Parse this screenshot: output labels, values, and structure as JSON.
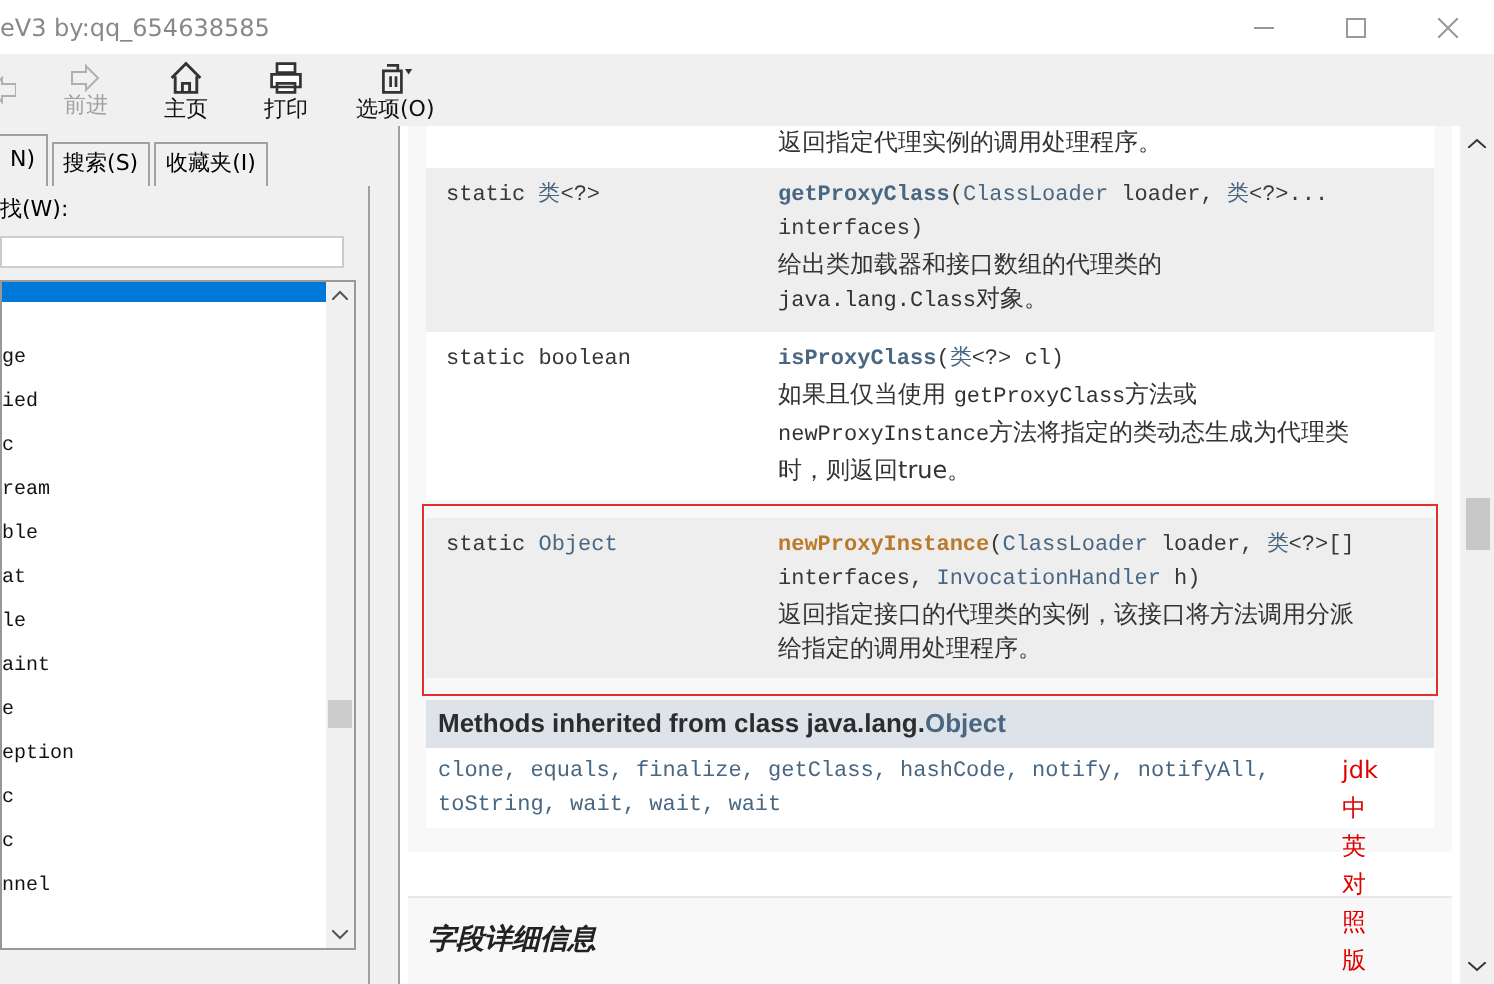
{
  "window": {
    "title": "eV3 by:qq_654638585"
  },
  "toolbar": [
    {
      "kind": "back",
      "disabled": true
    },
    {
      "kind": "forward",
      "label": "前进",
      "disabled": true
    },
    {
      "kind": "home",
      "label": "主页",
      "disabled": false
    },
    {
      "kind": "print",
      "label": "打印",
      "disabled": false
    },
    {
      "kind": "options",
      "label": "选项(O)",
      "disabled": false
    }
  ],
  "sidebar": {
    "tabs": [
      {
        "label": "N)",
        "selected": true
      },
      {
        "label": "搜索(S)",
        "selected": false
      },
      {
        "label": "收藏夹(I)",
        "selected": false
      }
    ],
    "find_label": "找(W):",
    "items": [
      {
        "selected": true
      },
      {
        "label": "ge",
        "selected": false
      },
      {
        "label": "ied",
        "selected": false
      },
      {
        "label": "c",
        "selected": false
      },
      {
        "label": "ream",
        "selected": false
      },
      {
        "label": "ble",
        "selected": false
      },
      {
        "label": "at",
        "selected": false
      },
      {
        "label": "le",
        "selected": false
      },
      {
        "label": "aint",
        "selected": false
      },
      {
        "label": "e",
        "selected": false
      },
      {
        "label": "eption",
        "selected": false
      },
      {
        "label": "c",
        "selected": false
      },
      {
        "label": "c",
        "selected": false
      },
      {
        "label": "nnel",
        "selected": false
      }
    ]
  },
  "methods": [
    {
      "description": [
        {
          "kind": "text",
          "text": "返回指定代理实例的调用处理程序。"
        }
      ],
      "highlighted": false
    },
    {
      "modifier": [
        {
          "kind": "plain",
          "text": "static "
        },
        {
          "kind": "type",
          "text": "类"
        },
        {
          "kind": "plain",
          "text": "<?>"
        }
      ],
      "signature": [
        {
          "kind": "name",
          "text": "getProxyClass"
        },
        {
          "kind": "plain",
          "text": "("
        },
        {
          "kind": "type",
          "text": "ClassLoader"
        },
        {
          "kind": "plain",
          "text": " loader, "
        },
        {
          "kind": "type",
          "text": "类"
        },
        {
          "kind": "plain",
          "text": "<?>... interfaces)"
        }
      ],
      "description": [
        {
          "kind": "text",
          "text": "给出类加载器和接口数组的代理类的 "
        },
        {
          "kind": "code",
          "text": "java.lang.Class"
        },
        {
          "kind": "text",
          "text": "对象。"
        }
      ],
      "highlighted": false
    },
    {
      "modifier": [
        {
          "kind": "plain",
          "text": "static boolean"
        }
      ],
      "signature": [
        {
          "kind": "name",
          "text": "isProxyClass"
        },
        {
          "kind": "plain",
          "text": "("
        },
        {
          "kind": "type",
          "text": "类"
        },
        {
          "kind": "plain",
          "text": "<?> cl)"
        }
      ],
      "description": [
        {
          "kind": "text",
          "text": "如果且仅当使用 "
        },
        {
          "kind": "code",
          "text": "getProxyClass"
        },
        {
          "kind": "text",
          "text": "方法或"
        },
        {
          "kind": "code",
          "text": "newProxyInstance"
        },
        {
          "kind": "text",
          "text": "方法将指定的类动态生成为代理类时，则返回true。"
        }
      ],
      "highlighted": false
    },
    {
      "modifier": [
        {
          "kind": "plain",
          "text": "static "
        },
        {
          "kind": "type",
          "text": "Object"
        }
      ],
      "signature": [
        {
          "kind": "name_highlight",
          "text": "newProxyInstance"
        },
        {
          "kind": "plain",
          "text": "("
        },
        {
          "kind": "type",
          "text": "ClassLoader"
        },
        {
          "kind": "plain",
          "text": " loader, "
        },
        {
          "kind": "type",
          "text": "类"
        },
        {
          "kind": "plain",
          "text": "<?>[] interfaces, "
        },
        {
          "kind": "type",
          "text": "InvocationHandler"
        },
        {
          "kind": "plain",
          "text": " h)"
        }
      ],
      "description": [
        {
          "kind": "text",
          "text": "返回指定接口的代理类的实例，该接口将方法调用分派给指定的调用处理程序。"
        }
      ],
      "highlighted": true
    }
  ],
  "inherited": {
    "title": "Methods inherited from class java.lang.",
    "class_link": "Object",
    "methods": "clone, equals, finalize, getClass, hashCode, notify, notifyAll, toString, wait, wait, wait"
  },
  "annotation": "jdk中英对照版",
  "section_heading": "字段详细信息"
}
